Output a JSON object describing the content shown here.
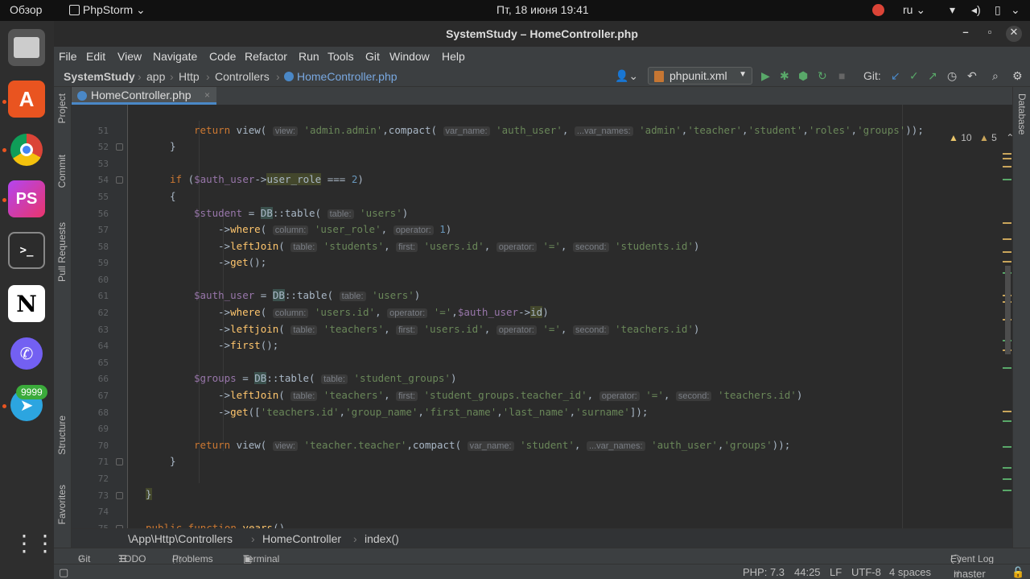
{
  "os": {
    "activities": "Обзор",
    "app_name": "PhpStorm",
    "clock": "Пт, 18 июня  19:41",
    "language": "ru",
    "telegram_badge": "9999"
  },
  "window": {
    "title": "SystemStudy – HomeController.php"
  },
  "menu": [
    "File",
    "Edit",
    "View",
    "Navigate",
    "Code",
    "Refactor",
    "Run",
    "Tools",
    "Git",
    "Window",
    "Help"
  ],
  "breadcrumb": [
    "SystemStudy",
    "app",
    "Http",
    "Controllers",
    "HomeController.php"
  ],
  "toolbar": {
    "run_config": "phpunit.xml",
    "git_label": "Git:"
  },
  "left_tools": [
    "Project",
    "Commit",
    "Pull Requests",
    "Structure",
    "Favorites"
  ],
  "right_tools": [
    "Database"
  ],
  "tab": {
    "label": "HomeController.php",
    "close": "×"
  },
  "inspections": {
    "warnings": "10",
    "weak": "5"
  },
  "line_numbers": [
    "51",
    "52",
    "53",
    "54",
    "55",
    "56",
    "57",
    "58",
    "59",
    "60",
    "61",
    "62",
    "63",
    "64",
    "65",
    "66",
    "67",
    "68",
    "69",
    "70",
    "71",
    "72",
    "73",
    "74",
    "75",
    "76"
  ],
  "editor_breadcrumb": [
    "\\App\\Http\\Controllers",
    "HomeController",
    "index()"
  ],
  "bottom_tools": [
    "Git",
    "TODO",
    "Problems",
    "Terminal",
    "Event Log"
  ],
  "status": {
    "php": "PHP: 7.3",
    "position": "44:25",
    "line_sep": "LF",
    "encoding": "UTF-8",
    "indent": "4 spaces",
    "branch": "master"
  },
  "code_hints": {
    "view": "view:",
    "var_name": "var_name:",
    "var_names": "...var_names:",
    "table": "table:",
    "column": "column:",
    "operator": "operator:",
    "first": "first:",
    "second": "second:"
  }
}
